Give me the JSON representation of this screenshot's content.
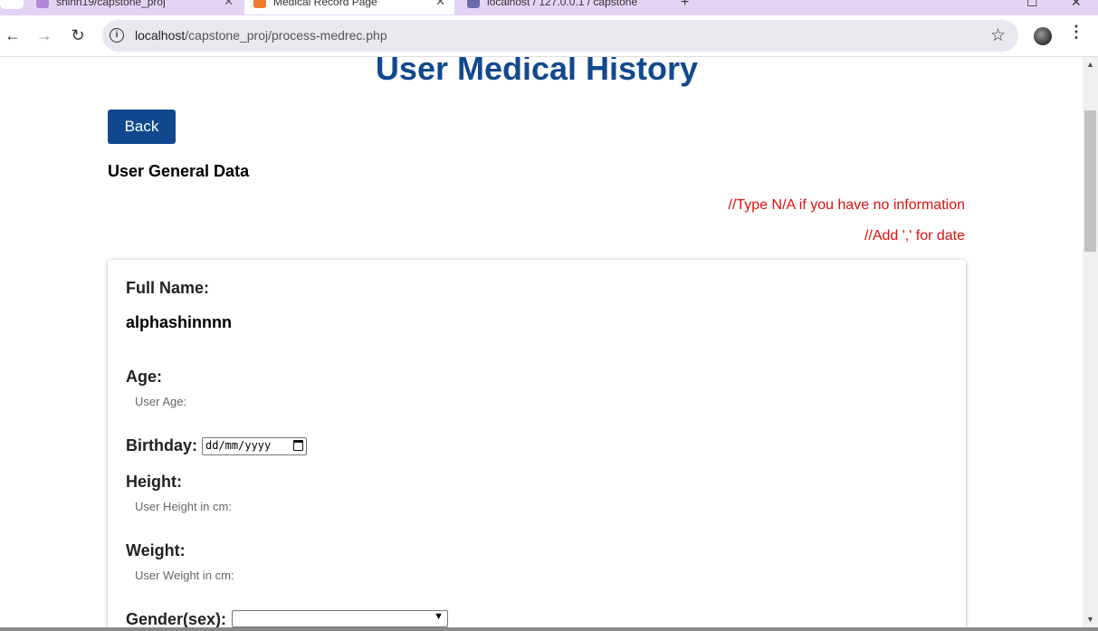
{
  "browser": {
    "tabs": [
      {
        "title": "shinn19/capstone_proj",
        "active": false,
        "favicon_color": "#b08ad8"
      },
      {
        "title": "Medical Record Page",
        "active": true,
        "favicon_color": "#f07a30"
      },
      {
        "title": "localhost / 127.0.0.1 / capstone",
        "active": false,
        "favicon_color": "#6b6bb0"
      }
    ],
    "new_tab_icon": "+",
    "window_controls": {
      "minimize": "–",
      "maximize": "☐",
      "close": "✕"
    },
    "nav": {
      "back": "←",
      "forward": "→",
      "reload": "↻"
    },
    "url": {
      "host": "localhost",
      "path": "/capstone_proj/process-medrec.php"
    },
    "bookmark_icon": "☆",
    "menu_icon": "⋮"
  },
  "page": {
    "title": "User Medical History",
    "back_label": "Back",
    "section_title": "User General Data",
    "notes": [
      "//Type N/A if you have no information",
      "//Add ',' for date"
    ],
    "fields": {
      "full_name": {
        "label": "Full Name:",
        "value": "alphashinnnn"
      },
      "age": {
        "label": "Age:",
        "hint": "User Age:"
      },
      "birthday": {
        "label": "Birthday:",
        "placeholder": "dd/mm/yyyy"
      },
      "height": {
        "label": "Height:",
        "hint": "User Height in cm:"
      },
      "weight": {
        "label": "Weight:",
        "hint": "User Weight in cm:"
      },
      "gender": {
        "label": "Gender(sex):",
        "selected": ""
      }
    }
  },
  "colors": {
    "brand_blue": "#12498e",
    "note_red": "#e10f0f",
    "tabstrip": "#e3d4f5"
  }
}
